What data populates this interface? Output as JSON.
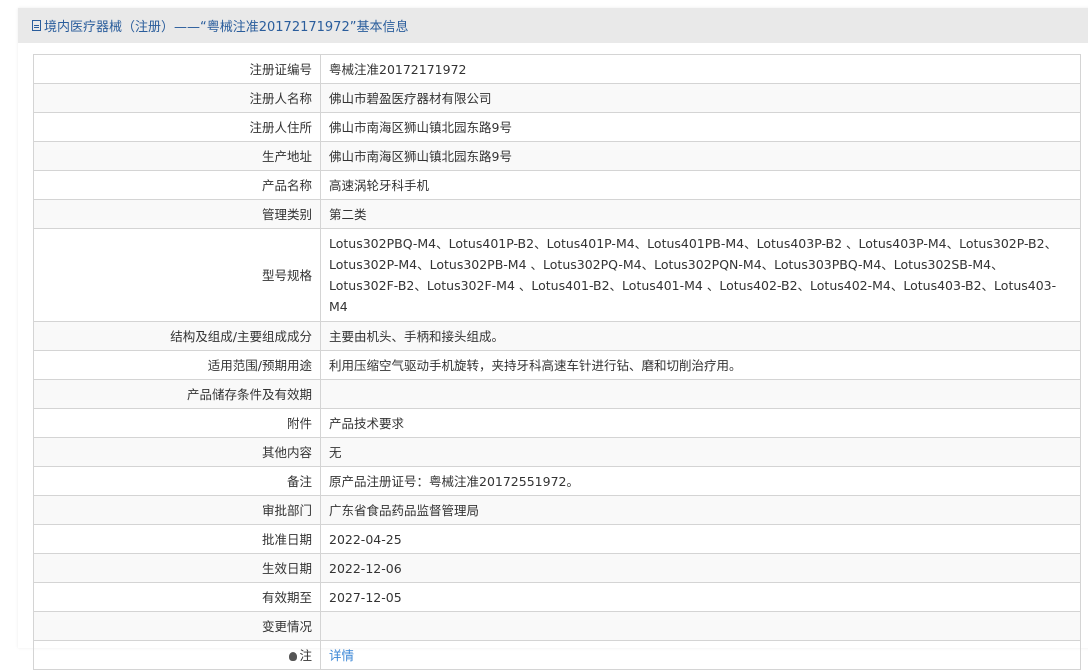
{
  "header": {
    "icon": "document-icon",
    "title": "境内医疗器械（注册）——“粤械注准20172171972”基本信息"
  },
  "rows": [
    {
      "label": "注册证编号",
      "value": "粤械注准20172171972"
    },
    {
      "label": "注册人名称",
      "value": "佛山市碧盈医疗器材有限公司"
    },
    {
      "label": "注册人住所",
      "value": "佛山市南海区狮山镇北园东路9号"
    },
    {
      "label": "生产地址",
      "value": "佛山市南海区狮山镇北园东路9号"
    },
    {
      "label": "产品名称",
      "value": "高速涡轮牙科手机"
    },
    {
      "label": "管理类别",
      "value": "第二类"
    },
    {
      "label": "型号规格",
      "value": "Lotus302PBQ-M4、Lotus401P-B2、Lotus401P-M4、Lotus401PB-M4、Lotus403P-B2 、Lotus403P-M4、Lotus302P-B2、Lotus302P-M4、Lotus302PB-M4 、Lotus302PQ-M4、Lotus302PQN-M4、Lotus303PBQ-M4、Lotus302SB-M4、Lotus302F-B2、Lotus302F-M4 、Lotus401-B2、Lotus401-M4 、Lotus402-B2、Lotus402-M4、Lotus403-B2、Lotus403-M4"
    },
    {
      "label": "结构及组成/主要组成成分",
      "value": "主要由机头、手柄和接头组成。"
    },
    {
      "label": "适用范围/预期用途",
      "value": "利用压缩空气驱动手机旋转，夹持牙科高速车针进行钻、磨和切削治疗用。"
    },
    {
      "label": "产品储存条件及有效期",
      "value": ""
    },
    {
      "label": "附件",
      "value": "产品技术要求"
    },
    {
      "label": "其他内容",
      "value": "无"
    },
    {
      "label": "备注",
      "value": "原产品注册证号：粤械注准20172551972。"
    },
    {
      "label": "审批部门",
      "value": "广东省食品药品监督管理局"
    },
    {
      "label": "批准日期",
      "value": "2022-04-25"
    },
    {
      "label": "生效日期",
      "value": "2022-12-06"
    },
    {
      "label": "有效期至",
      "value": "2027-12-05"
    },
    {
      "label": "变更情况",
      "value": ""
    }
  ],
  "note": {
    "icon": "lightbulb-icon",
    "label": "注",
    "link": "详情"
  }
}
